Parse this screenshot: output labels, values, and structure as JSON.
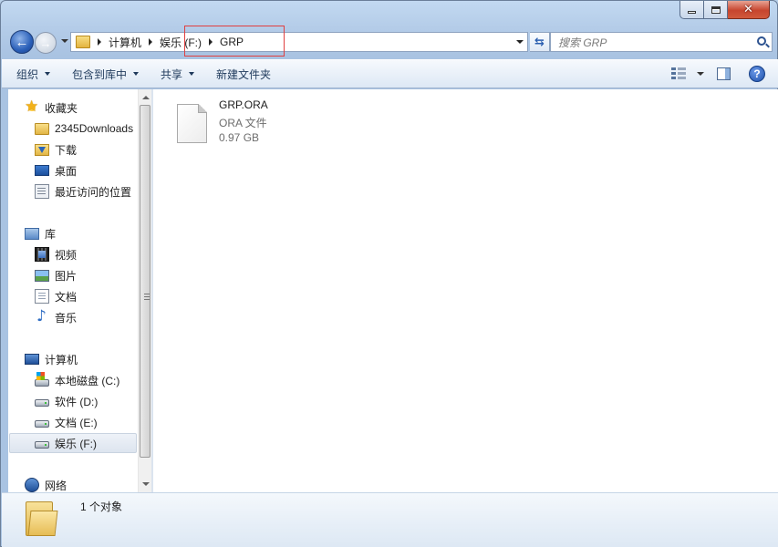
{
  "window": {
    "minimize_label": "minimize",
    "maximize_label": "maximize",
    "close_glyph": "✕"
  },
  "navigation": {
    "back_glyph": "←",
    "forward_glyph": "→"
  },
  "address": {
    "segments": [
      "计算机",
      "娱乐 (F:)",
      "GRP"
    ]
  },
  "search": {
    "placeholder": "搜索 GRP"
  },
  "toolbar": {
    "organize": "组织",
    "include_in_library": "包含到库中",
    "share": "共享",
    "new_folder": "新建文件夹",
    "help_glyph": "?"
  },
  "sidebar": {
    "favorites": {
      "label": "收藏夹",
      "items": [
        "2345Downloads",
        "下载",
        "桌面",
        "最近访问的位置"
      ]
    },
    "libraries": {
      "label": "库",
      "items": [
        "视频",
        "图片",
        "文档",
        "音乐"
      ]
    },
    "computer": {
      "label": "计算机",
      "items": [
        "本地磁盘 (C:)",
        "软件 (D:)",
        "文档 (E:)",
        "娱乐 (F:)"
      ],
      "selected": "娱乐 (F:)"
    },
    "network": {
      "label": "网络"
    }
  },
  "files": [
    {
      "name": "GRP.ORA",
      "type": "ORA 文件",
      "size": "0.97 GB",
      "icon": "generic-file-icon"
    }
  ],
  "details": {
    "count_text": "1 个对象"
  },
  "colors": {
    "frame": "#b4cce8",
    "highlight_box": "#e04040",
    "text_muted": "#6d6d6d"
  }
}
